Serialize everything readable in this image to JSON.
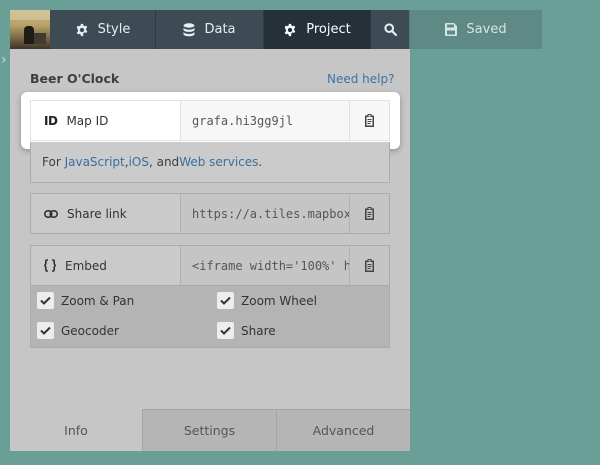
{
  "toolbar": {
    "style_label": "Style",
    "data_label": "Data",
    "project_label": "Project",
    "saved_label": "Saved",
    "icons": {
      "style": "gear-icon",
      "data": "database-icon",
      "project": "gear-icon",
      "search": "search-icon",
      "saved": "save-icon"
    }
  },
  "panel": {
    "title": "Beer O'Clock",
    "help_link": "Need help?",
    "map_id": {
      "badge": "ID",
      "label": "Map ID",
      "value": "grafa.hi3gg9jl"
    },
    "sdk": {
      "prefix": "For ",
      "links": [
        "JavaScript",
        "iOS",
        "Web services"
      ],
      "sep1": ", ",
      "sep2": ", and ",
      "suffix": "."
    },
    "share": {
      "label": "Share link",
      "value": "https://a.tiles.mapbox."
    },
    "embed": {
      "label": "Embed",
      "value": "<iframe width='100%' he"
    },
    "options": [
      {
        "label": "Zoom & Pan",
        "checked": true
      },
      {
        "label": "Zoom Wheel",
        "checked": true
      },
      {
        "label": "Geocoder",
        "checked": true
      },
      {
        "label": "Share",
        "checked": true
      }
    ]
  },
  "tabs": {
    "info": "Info",
    "settings": "Settings",
    "advanced": "Advanced"
  },
  "colors": {
    "map": "#6a9f98",
    "toolbar": "#3d4b55",
    "toolbar_active": "#263039",
    "saved": "#5e8985",
    "link": "#3a75a7"
  }
}
